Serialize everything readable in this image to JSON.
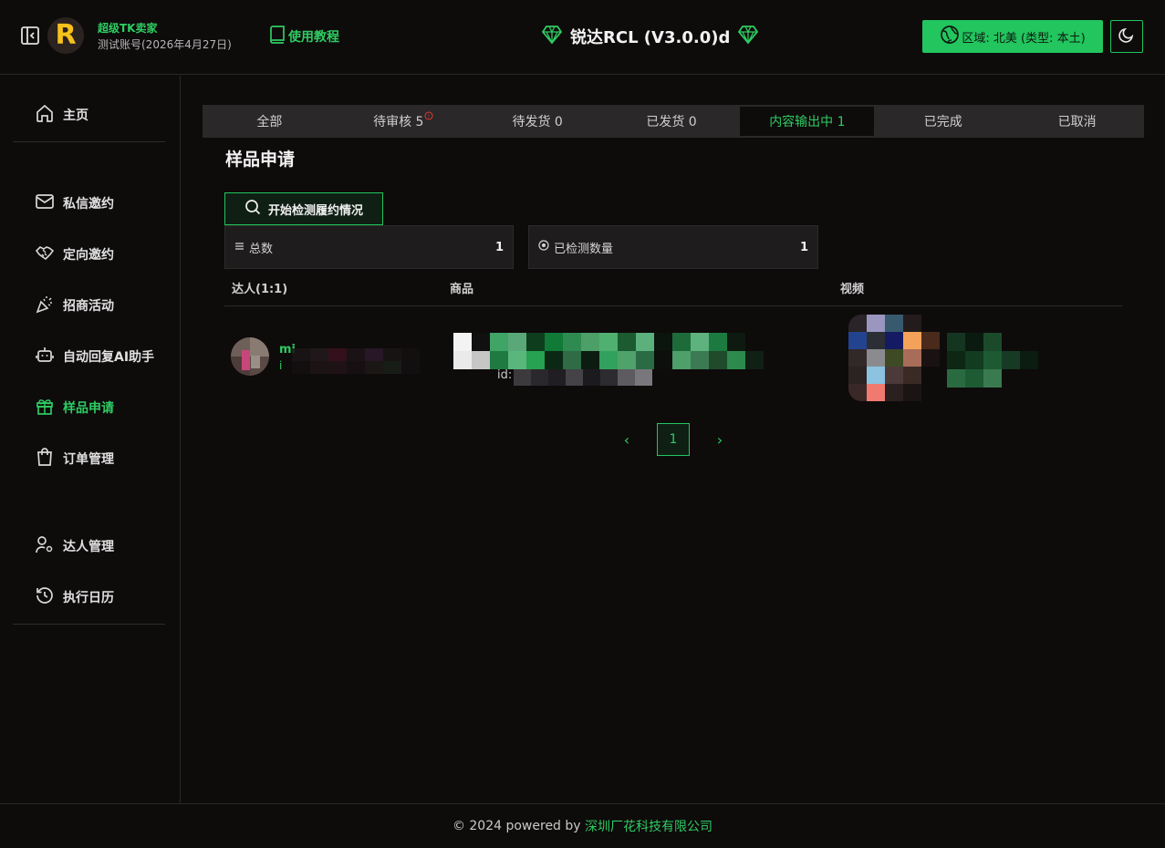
{
  "header": {
    "account_name": "超级TK卖家",
    "account_sub": "测试账号(2026年4月27日)",
    "logo_letter": "R",
    "tutorial_label": "使用教程",
    "app_title": "锐达RCL (V3.0.0)d",
    "region_label": "区域: 北美 (类型: 本土)"
  },
  "sidebar": {
    "items": [
      {
        "label": "主页",
        "icon": "home-icon"
      },
      {
        "label": "私信邀约",
        "icon": "mail-icon"
      },
      {
        "label": "定向邀约",
        "icon": "handshake-icon"
      },
      {
        "label": "招商活动",
        "icon": "party-popper-icon"
      },
      {
        "label": "自动回复AI助手",
        "icon": "bot-icon"
      },
      {
        "label": "样品申请",
        "icon": "gift-icon",
        "active": true
      },
      {
        "label": "订单管理",
        "icon": "shopping-bag-icon"
      },
      {
        "label": "达人管理",
        "icon": "user-cog-icon"
      },
      {
        "label": "执行日历",
        "icon": "history-icon"
      }
    ]
  },
  "tabs": [
    {
      "label": "全部"
    },
    {
      "label": "待审核 5",
      "badge": "!"
    },
    {
      "label": "待发货 0"
    },
    {
      "label": "已发货 0"
    },
    {
      "label": "内容输出中 1",
      "active": true
    },
    {
      "label": "已完成"
    },
    {
      "label": "已取消"
    }
  ],
  "main": {
    "section_title": "样品申请",
    "check_button": "开始检测履约情况",
    "stats": [
      {
        "label": "总数",
        "value": "1",
        "icon": "list-icon"
      },
      {
        "label": "已检测数量",
        "value": "1",
        "icon": "circle-dot-icon"
      }
    ],
    "columns": [
      "达人(1:1)",
      "商品",
      "视频"
    ],
    "row": {
      "creator_prefix": "mi",
      "creator_id_prefix": "i",
      "product_id_prefix": "id:"
    }
  },
  "pagination": {
    "current": "1",
    "prev": "‹",
    "next": "›"
  },
  "footer": {
    "prefix": "© 2024 powered by ",
    "company": "深圳厂花科技有限公司"
  },
  "colors": {
    "accent": "#22c55e",
    "background": "#0e0b0b",
    "badge": "#e53935"
  }
}
